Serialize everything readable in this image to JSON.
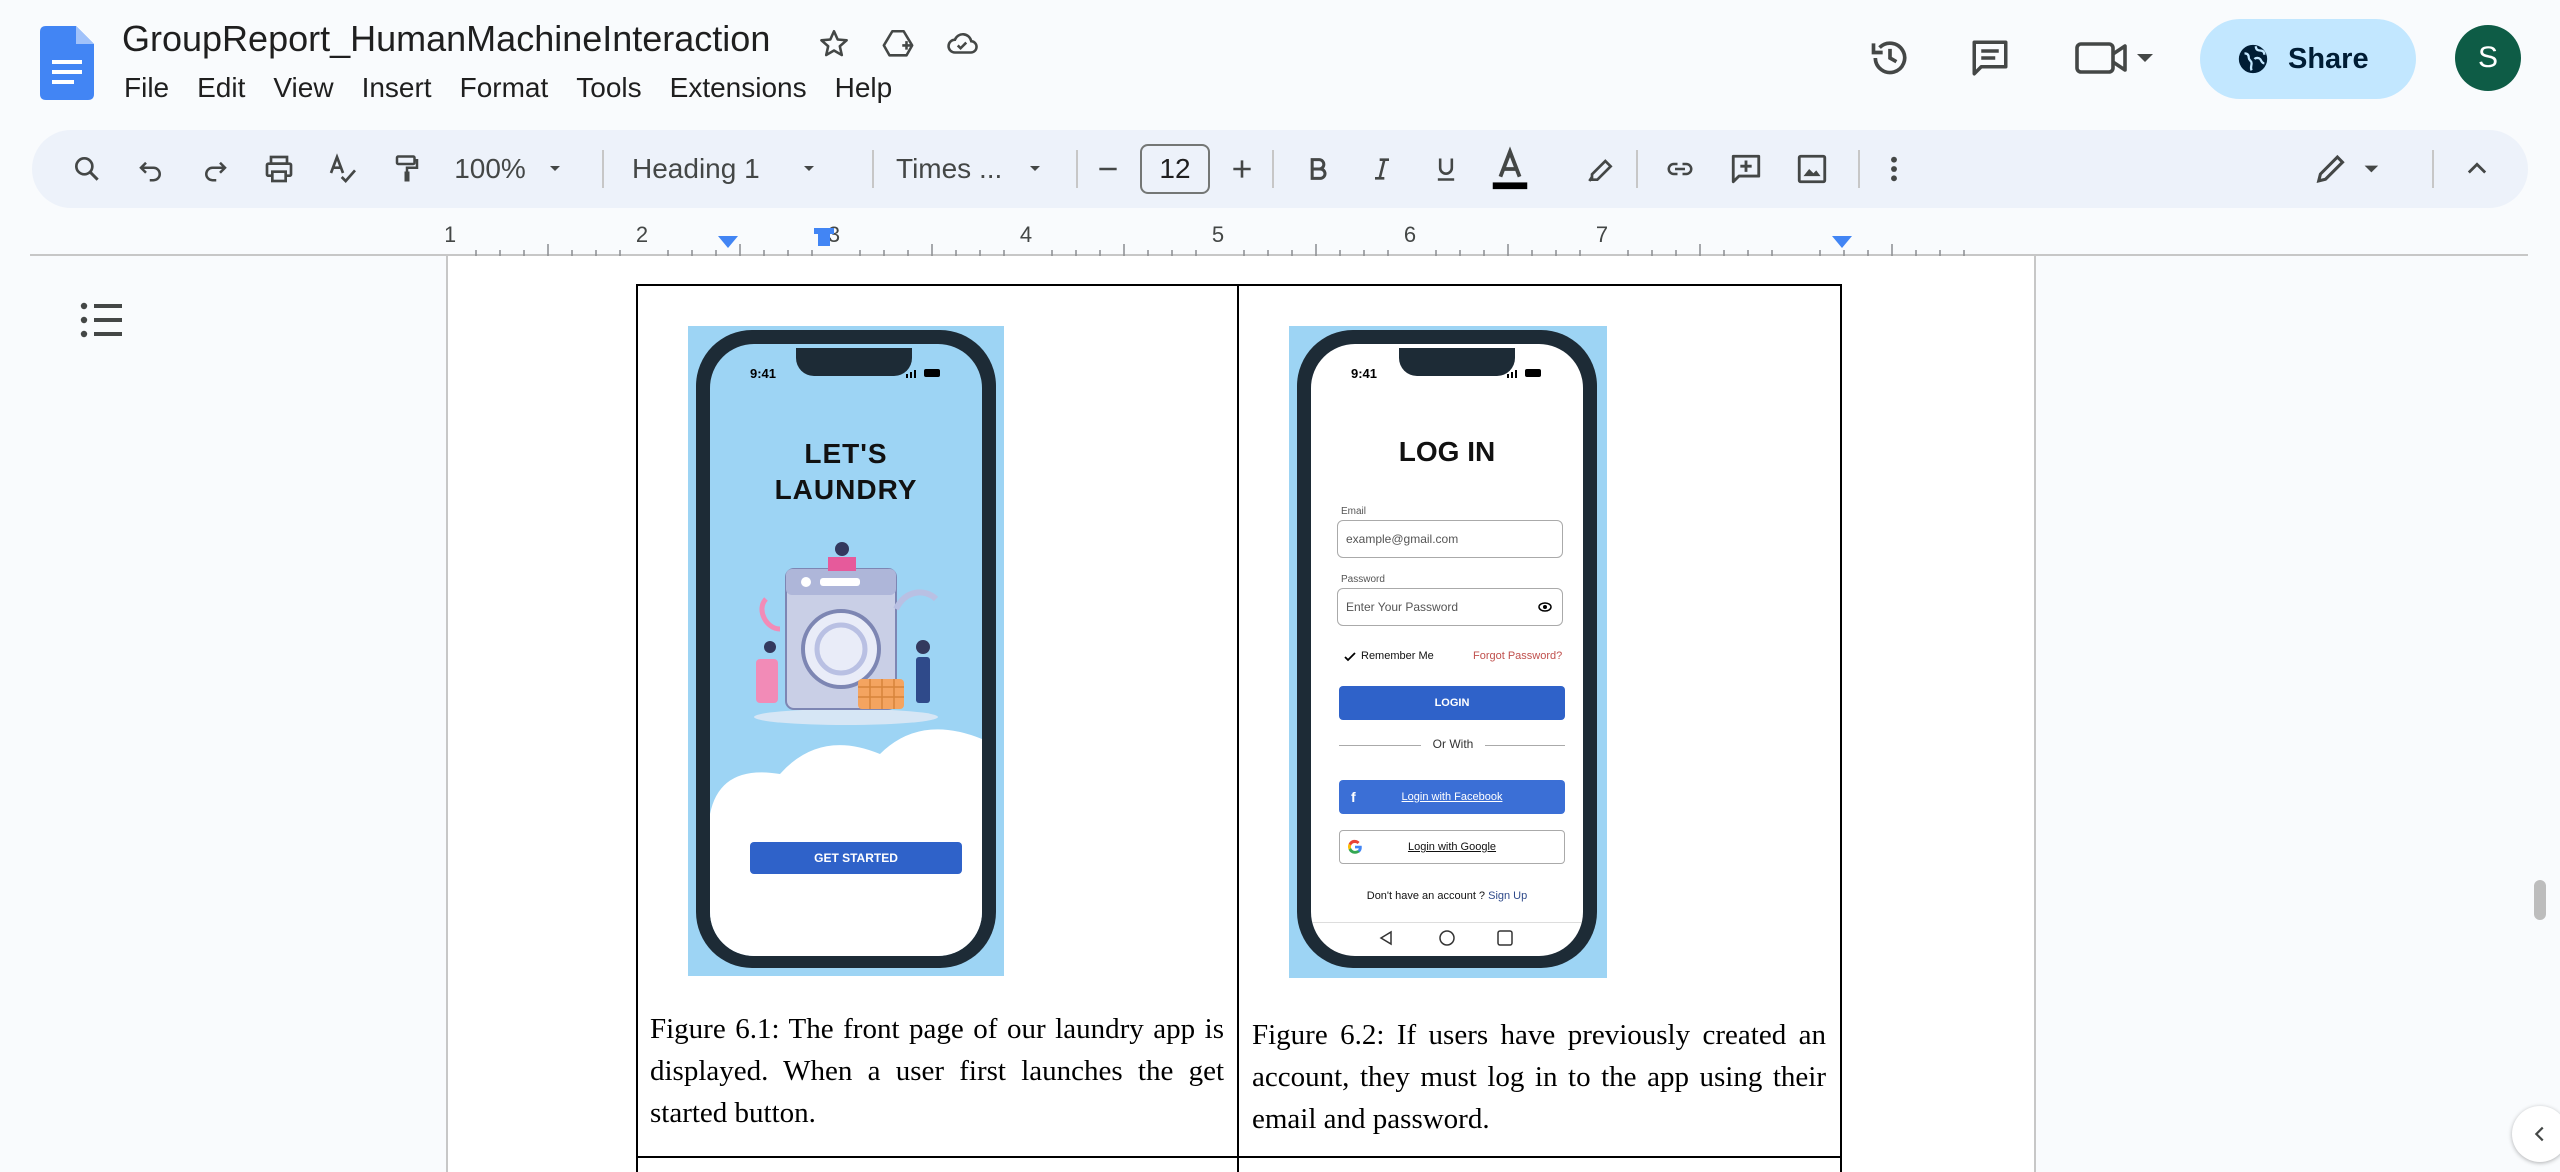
{
  "document": {
    "title": "GroupReport_HumanMachineInteraction"
  },
  "menu": {
    "items": [
      "File",
      "Edit",
      "View",
      "Insert",
      "Format",
      "Tools",
      "Extensions",
      "Help"
    ]
  },
  "header": {
    "share_label": "Share",
    "avatar_initial": "S"
  },
  "toolbar": {
    "zoom": "100%",
    "style": "Heading 1",
    "font": "Times ...",
    "font_size": "12"
  },
  "ruler": {
    "labels": [
      "1",
      "2",
      "3",
      "4",
      "5",
      "6",
      "7"
    ]
  },
  "figures": [
    {
      "caption": "Figure 6.1: The front page of our laundry app is displayed. When a user first launches the get started button.",
      "phone": {
        "time": "9:41",
        "heading_line1": "LET'S",
        "heading_line2": "LAUNDRY",
        "button": "GET STARTED"
      }
    },
    {
      "caption": "Figure 6.2: If users have previously created an account, they must  log in to the app using their email and password.",
      "phone": {
        "time": "9:41",
        "heading": "LOG IN",
        "email_label": "Email",
        "email_value": "example@gmail.com",
        "password_label": "Password",
        "password_placeholder": "Enter Your Password",
        "remember_me": "Remember Me",
        "forgot_password": "Forgot Password?",
        "login_button": "LOGIN",
        "or_with": "Or With",
        "facebook_button": "Login with Facebook",
        "google_button": "Login with Google",
        "no_account": "Don't have an account ?",
        "sign_up": "Sign Up"
      }
    }
  ],
  "colors": {
    "share_bg": "#c2e7ff",
    "toolbar_bg": "#edf2fa",
    "avatar_bg": "#0e5c46",
    "docs_blue": "#4285f4",
    "phone_bg": "#9dd4f4",
    "login_blue": "#2f62c9",
    "facebook_blue": "#3b6fd6"
  }
}
